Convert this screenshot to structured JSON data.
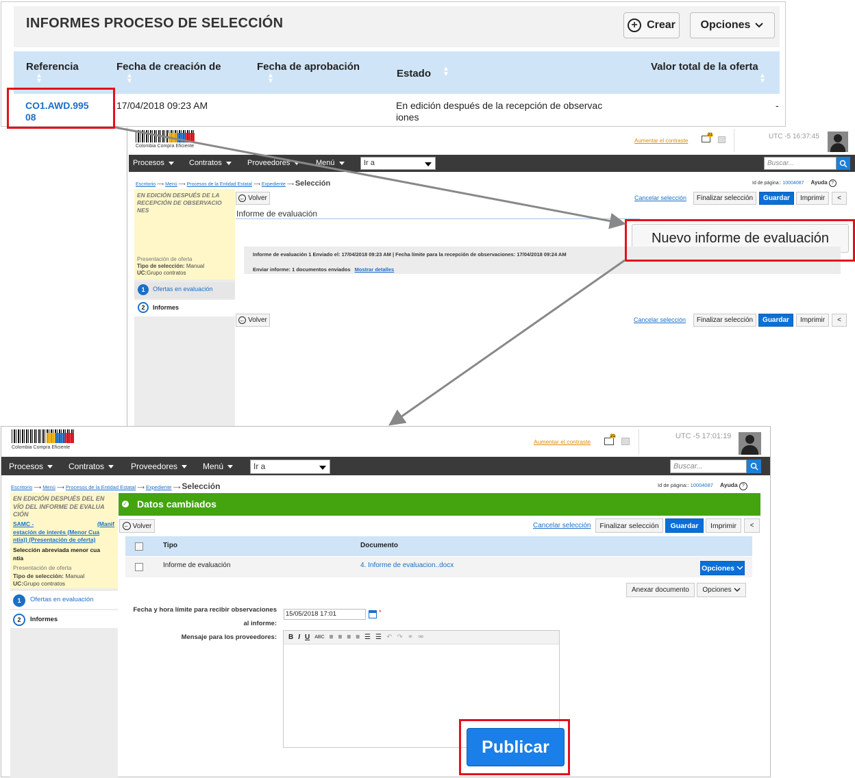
{
  "report_list": {
    "title": "INFORMES PROCESO DE SELECCIÓN",
    "create_label": "Crear",
    "options_label": "Opciones",
    "columns": [
      "Referencia",
      "Fecha de creación de",
      "Fecha de aprobación",
      "Estado",
      "Valor total de la oferta"
    ],
    "row": {
      "reference_line1": "CO1.AWD.995",
      "reference_line2": "08",
      "created": "17/04/2018 09:23 AM",
      "status_line1": "En edición después de la recepción de observac",
      "status_line2": "iones",
      "total": "-"
    }
  },
  "screen1": {
    "logo_text": "Colombia Compra Eficiente",
    "contrast_link": "Aumentar el contraste",
    "mail_badge": "21",
    "clock": "UTC -5 16:37:45",
    "nav": [
      "Procesos",
      "Contratos",
      "Proveedores",
      "Menú"
    ],
    "goto": "Ir a",
    "search_placeholder": "Buscar...",
    "breadcrumb": [
      "Escritorio",
      "Menú",
      "Procesos de la Entidad Estatal",
      "Expediente"
    ],
    "breadcrumb_current": "Selección",
    "page_id_label": "Id de página::",
    "page_id": "10004087",
    "help": "Ayuda",
    "status_line1": "EN EDICIÓN DESPUÉS DE LA",
    "status_line2": "RECEPCIÓN DE OBSERVACIO",
    "status_line3": "NES",
    "phase": "Presentación de oferta",
    "selection_type_label": "Tipo de selección:",
    "selection_type": "Manual",
    "uc_label": "UC:",
    "uc": "Grupo contratos",
    "steps": [
      {
        "num": "1",
        "label": "Ofertas en evaluación"
      },
      {
        "num": "2",
        "label": "Informes"
      }
    ],
    "back": "Volver",
    "cancel": "Cancelar selección",
    "finish": "Finalizar selección",
    "save": "Guardar",
    "print": "Imprimir",
    "collapse": "<",
    "section_title": "Informe de evaluación",
    "new_report_button": "Nuevo informe de evaluación",
    "info_line1": "Informe de evaluación 1  Enviado el: 17/04/2018 09:23 AM | Fecha límite para la recepción de observaciones: 17/04/2018 09:24 AM",
    "info_line2_label": "Enviar informe:  1 documentos enviados",
    "info_line2_link": "Mostrar detalles"
  },
  "screen2": {
    "logo_text": "Colombia Compra Eficiente",
    "contrast_link": "Aumentar el contraste",
    "mail_badge": "21",
    "clock": "UTC -5 17:01:19",
    "nav": [
      "Procesos",
      "Contratos",
      "Proveedores",
      "Menú"
    ],
    "goto": "Ir a",
    "search_placeholder": "Buscar...",
    "breadcrumb": [
      "Escritorio",
      "Menú",
      "Procesos de la Entidad Estatal",
      "Expediente"
    ],
    "breadcrumb_current": "Selección",
    "page_id_label": "Id de página::",
    "page_id": "10004087",
    "help": "Ayuda",
    "status_line1": "EN EDICIÓN DESPUÉS DEL EN",
    "status_line2": "VÍO DEL INFORME DE EVALUA",
    "status_line3": "CIÓN",
    "process_link_line1a": "SAMC -",
    "process_link_line1b": "(Manif",
    "process_link_line2": "estación de interés (Menor Cua",
    "process_link_line3": "ntía)) (Presentación de oferta)",
    "abbreviated_line1": "Selección abreviada menor cua",
    "abbreviated_line2": "ntía",
    "phase": "Presentación de oferta",
    "selection_type_label": "Tipo de selección:",
    "selection_type": "Manual",
    "uc_label": "UC:",
    "uc": "Grupo contratos",
    "steps": [
      {
        "num": "1",
        "label": "Ofertas en evaluación"
      },
      {
        "num": "2",
        "label": "Informes"
      }
    ],
    "banner": "Datos cambiados",
    "back": "Volver",
    "cancel": "Cancelar selección",
    "finish": "Finalizar selección",
    "save": "Guardar",
    "print": "Imprimir",
    "collapse": "<",
    "table_headers": [
      "Tipo",
      "Documento"
    ],
    "table_row": {
      "type": "Informe de evaluación",
      "document": "4. Informe de evaluacion..docx",
      "options": "Opciones"
    },
    "attach": "Anexar documento",
    "options": "Opciones",
    "deadline_label_line1": "Fecha y hora límite para recibir observaciones",
    "deadline_label_line2": "al informe:",
    "deadline_value": "15/05/2018 17:01",
    "message_label": "Mensaje para los proveedores:",
    "publish": "Publicar"
  },
  "colors": {
    "accent_blue": "#0a6fd6",
    "highlight_red": "#e3101a",
    "banner_green": "#43a40f",
    "table_header_blue": "#cfe4f7",
    "nav_dark": "#3a3a3a"
  }
}
